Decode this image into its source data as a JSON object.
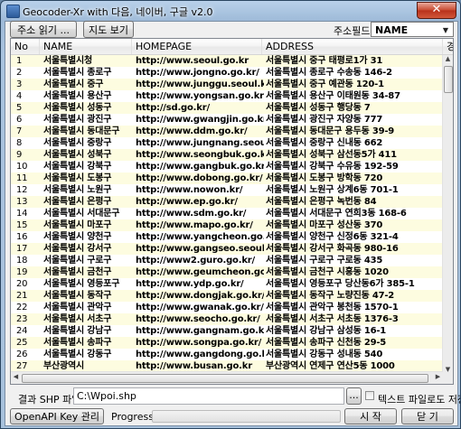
{
  "window": {
    "title": "Geocoder-Xr with 다음, 네이버, 구글 v2.0",
    "close_label": "✕"
  },
  "toolbar": {
    "read_address_label": "주소 읽기 ...",
    "map_view_label": "지도 보기",
    "address_field_label": "주소필드",
    "address_field_value": "NAME"
  },
  "table": {
    "columns": [
      "No",
      "NAME",
      "HOMEPAGE",
      "ADDRESS",
      "경"
    ],
    "rows": [
      [
        "1",
        "서울특별시청",
        "http://www.seoul.go.kr",
        "서울특별시 중구 태평로1가 31"
      ],
      [
        "2",
        "서울특별시 종로구",
        "http://www.jongno.go.kr/",
        "서울특별시 종로구 수송동 146-2"
      ],
      [
        "3",
        "서울특별시 중구",
        "http://www.junggu.seoul.kr/",
        "서울특별시 중구 예관동 120-1"
      ],
      [
        "4",
        "서울특별시 용산구",
        "http://www.yongsan.go.kr/",
        "서울특별시 용산구 이태원동 34-87"
      ],
      [
        "5",
        "서울특별시 성동구",
        "http://sd.go.kr/",
        "서울특별시 성동구 행당동 7"
      ],
      [
        "6",
        "서울특별시 광진구",
        "http://www.gwangjin.go.kr/",
        "서울특별시 광진구 자양동 777"
      ],
      [
        "7",
        "서울특별시 동대문구",
        "http://www.ddm.go.kr/",
        "서울특별시 동대문구 용두동 39-9"
      ],
      [
        "8",
        "서울특별시 중랑구",
        "http://www.jungnang.seoul.kr/",
        "서울특별시 중랑구 신내동 662"
      ],
      [
        "9",
        "서울특별시 성북구",
        "http://www.seongbuk.go.kr/",
        "서울특별시 성북구 삼선동5가 411"
      ],
      [
        "10",
        "서울특별시 강북구",
        "http://www.gangbuk.go.kr/",
        "서울특별시 강북구 수유동 192-59"
      ],
      [
        "11",
        "서울특별시 도봉구",
        "http://www.dobong.go.kr/",
        "서울특별시 도봉구 방학동 720"
      ],
      [
        "12",
        "서울특별시 노원구",
        "http://www.nowon.kr/",
        "서울특별시 노원구 상계6동 701-1"
      ],
      [
        "13",
        "서울특별시 은평구",
        "http://www.ep.go.kr/",
        "서울특별시 은평구 녹번동 84"
      ],
      [
        "14",
        "서울특별시 서대문구",
        "http://www.sdm.go.kr/",
        "서울특별시 서대문구 연희3동 168-6"
      ],
      [
        "15",
        "서울특별시 마포구",
        "http://www.mapo.go.kr/",
        "서울특별시 마포구 성산동 370"
      ],
      [
        "16",
        "서울특별시 양천구",
        "http://www.yangcheon.go.kr/",
        "서울특별시 양천구 신정6동 321-4"
      ],
      [
        "17",
        "서울특별시 강서구",
        "http://www.gangseo.seoul.kr/",
        "서울특별시 강서구 화곡동 980-16"
      ],
      [
        "18",
        "서울특별시 구로구",
        "http://www2.guro.go.kr/",
        "서울특별시 구로구 구로동 435"
      ],
      [
        "19",
        "서울특별시 금천구",
        "http://www.geumcheon.go.kr/",
        "서울특별시 금천구 시흥동 1020"
      ],
      [
        "20",
        "서울특별시 영등포구",
        "http://www.ydp.go.kr/",
        "서울특별시 영등포구 당산동6가 385-1"
      ],
      [
        "21",
        "서울특별시 동작구",
        "http://www.dongjak.go.kr/",
        "서울특별시 동작구 노량진동 47-2"
      ],
      [
        "22",
        "서울특별시 관악구",
        "http://www.gwanak.go.kr/",
        "서울특별시 관악구 봉천동 1570-1"
      ],
      [
        "23",
        "서울특별시 서초구",
        "http://www.seocho.go.kr/",
        "서울특별시 서초구 서초동 1376-3"
      ],
      [
        "24",
        "서울특별시 강남구",
        "http://www.gangnam.go.kr/",
        "서울특별시 강남구 삼성동 16-1"
      ],
      [
        "25",
        "서울특별시 송파구",
        "http://www.songpa.go.kr/",
        "서울특별시 송파구 신천동 29-5"
      ],
      [
        "26",
        "서울특별시 강동구",
        "http://www.gangdong.go.kr/",
        "서울특별시 강동구 성내동 540"
      ],
      [
        "27",
        "부산광역시",
        "http://www.busan.go.kr",
        "부산광역시 연제구 연산5동 1000"
      ]
    ]
  },
  "output": {
    "label": "결과 SHP 파일",
    "path_value": "C:\\Wpoi.shp",
    "browse_label": "...",
    "text_file_checkbox_label": "텍스트 파일로도 저장"
  },
  "bottom": {
    "openapi_label": "OpenAPI Key 관리 ...",
    "progress_label": "Progress",
    "progress_fraction": 0,
    "start_label": "시 작",
    "close_label": "닫 기"
  },
  "colors": {
    "row_alt": "#fdfce0",
    "titlebar": "#b9d1ea",
    "close_button": "#c7482e"
  }
}
